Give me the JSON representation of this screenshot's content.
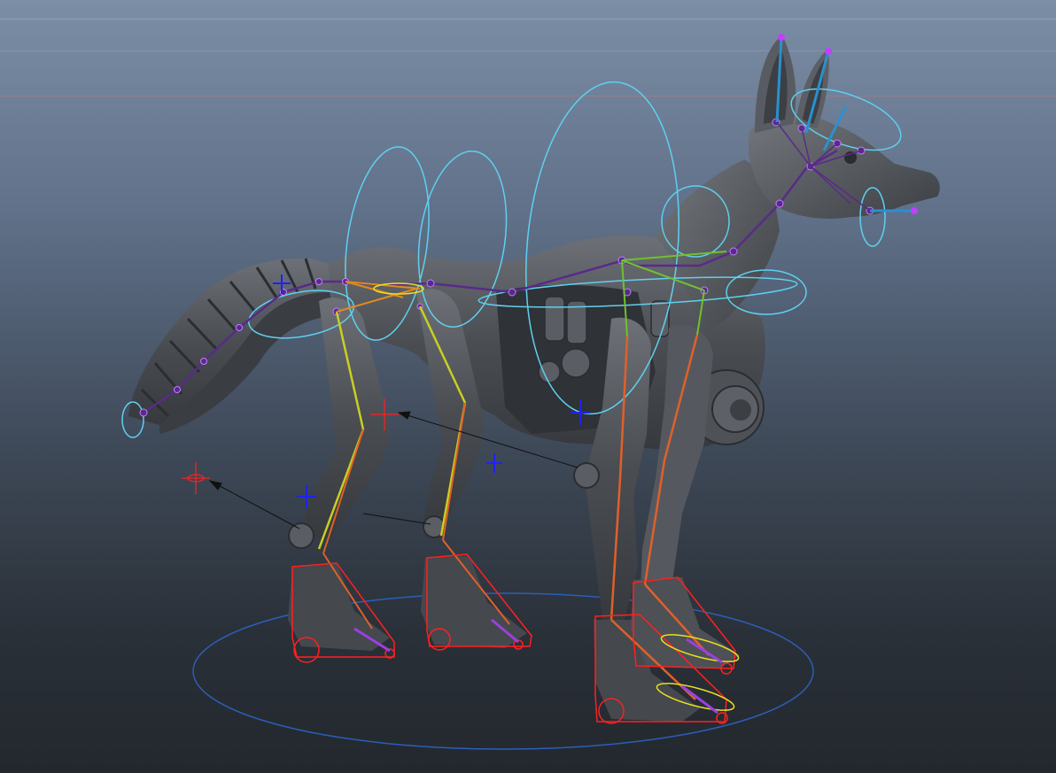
{
  "viewport": {
    "panel": "persp",
    "background_top": "#7c8ea6",
    "background_bottom": "#23282e"
  },
  "scene": {
    "subject": "mechanical-fox-rig",
    "colors": {
      "mesh": "#4a4d52",
      "mesh_highlight": "#6b6f75",
      "fk_circle": "#5fd0f0",
      "spine_joint": "#5a2a8a",
      "left_leg_bone": "#c8d020",
      "right_leg_bone": "#e0602a",
      "neck_bone": "#70c030",
      "ear_bone": "#2a90d0",
      "foot_box": "#ff2020",
      "toe_curve": "#e8e020",
      "pole_vector": "#ff2020",
      "locator": "#2020ff",
      "ground_circle": "#2a5fb8"
    }
  }
}
